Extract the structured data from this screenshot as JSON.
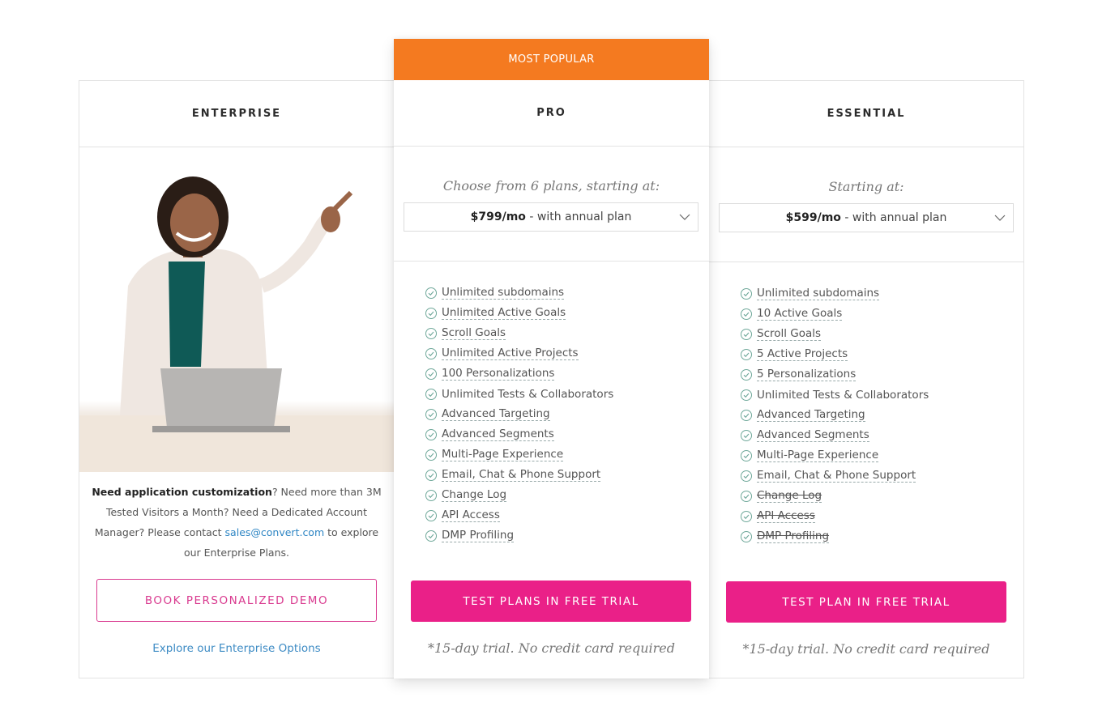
{
  "colors": {
    "accent_orange": "#f47a20",
    "cta_pink": "#ea2088",
    "link_blue": "#2f86c4"
  },
  "enterprise": {
    "title": "ENTERPRISE",
    "text_bold": "Need application customization",
    "text_part1": "? Need more than 3M Tested Visitors a Month? Need a Dedicated Account Manager? Please contact ",
    "email": "sales@convert.com",
    "text_part2": " to explore our Enterprise Plans.",
    "demo_button": "BOOK PERSONALIZED DEMO",
    "link": "Explore our Enterprise Options"
  },
  "pro": {
    "badge": "MOST POPULAR",
    "title": "PRO",
    "price_intro": "Choose from 6 plans, starting at:",
    "price": "$799/mo",
    "price_suffix": " - with annual plan",
    "features": [
      "Unlimited subdomains",
      "Unlimited Active Goals",
      "Scroll Goals",
      "Unlimited Active Projects",
      "100 Personalizations",
      "Unlimited Tests & Collaborators",
      "Advanced Targeting",
      "Advanced Segments",
      "Multi-Page Experience",
      "Email, Chat & Phone Support",
      "Change Log",
      "API Access",
      "DMP Profiling"
    ],
    "cta": "TEST PLANS IN FREE TRIAL",
    "trial_note": "*15-day trial. No credit card required"
  },
  "essential": {
    "title": "ESSENTIAL",
    "price_intro": "Starting at:",
    "price": "$599/mo",
    "price_suffix": " - with annual plan",
    "features": [
      "Unlimited subdomains",
      "10 Active Goals",
      "Scroll Goals",
      "5 Active Projects",
      "5 Personalizations",
      "Unlimited Tests & Collaborators",
      "Advanced Targeting",
      "Advanced Segments",
      "Multi-Page Experience",
      "Email, Chat & Phone Support",
      "Change Log",
      "API Access",
      "DMP Profiling"
    ],
    "cta": "TEST PLAN IN FREE TRIAL",
    "trial_note": "*15-day trial. No credit card required"
  },
  "icons": {
    "feature": "check-circle-icon",
    "dropdown": "chevron-down-icon"
  }
}
